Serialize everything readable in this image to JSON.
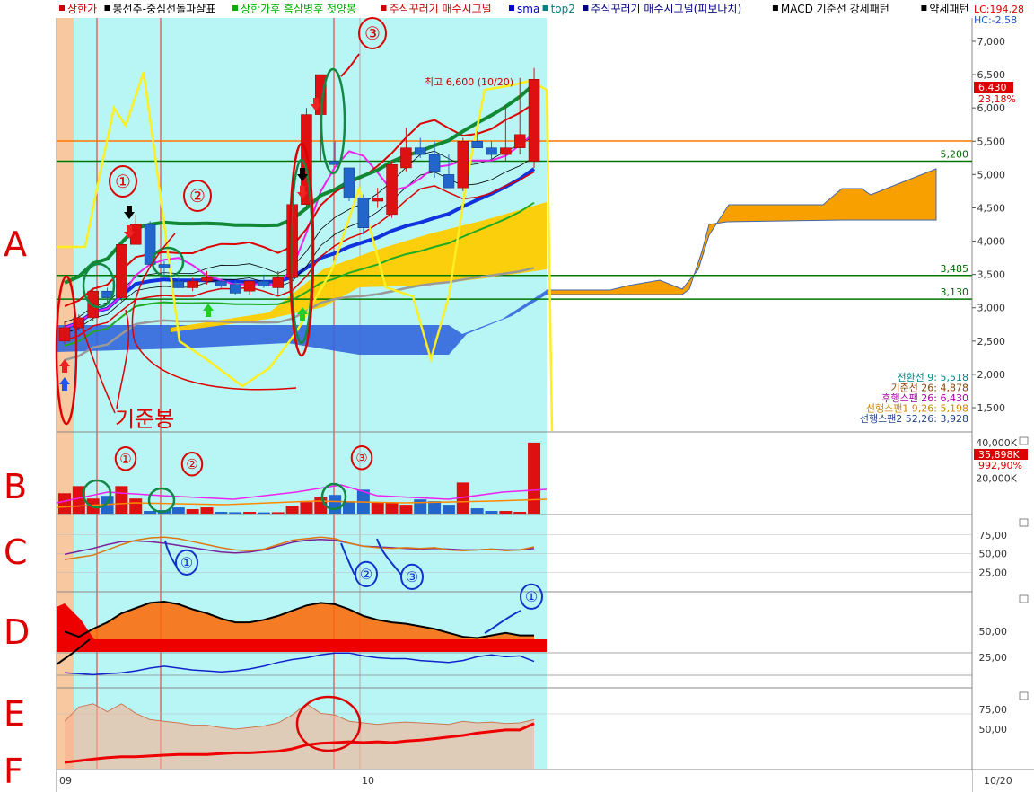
{
  "legend": [
    {
      "label": "상한가",
      "color": "#cc0000"
    },
    {
      "label": "봉선추-중심선돌파샬표",
      "color": "#000000"
    },
    {
      "label": "상한가후 흑삼병후 첫양봉",
      "color": "#00b000"
    },
    {
      "label": "주식꾸러기 매수시그널",
      "color": "#cc0000"
    },
    {
      "label": "sma",
      "color": "#0000cc"
    },
    {
      "label": "top2",
      "color": "#008080"
    },
    {
      "label": "주식꾸러기 매수시그널(피보나치)",
      "color": "#000080"
    },
    {
      "label": "MACD 기준선 강세패턴",
      "color": "#000000"
    },
    {
      "label": "약세패턴",
      "color": "#000000"
    }
  ],
  "top_right": {
    "lc": "LC:194,28",
    "hc": "HC:-2,58"
  },
  "price_axis": {
    "ticks": [
      "7,000",
      "6,500",
      "6,000",
      "5,500",
      "5,000",
      "4,500",
      "4,000",
      "3,500",
      "3,000",
      "2,500",
      "2,000",
      "1,500"
    ]
  },
  "price_badge": {
    "price": "6,430",
    "pct": "23,18%"
  },
  "high_marker": "최고 6,600 (10/20)",
  "hlines": [
    {
      "label": "5,200",
      "color": "#007700"
    },
    {
      "label": "3,485",
      "color": "#007700"
    },
    {
      "label": "3,130",
      "color": "#007700"
    }
  ],
  "ichimoku_legend": [
    {
      "text": "전환선 9: 5,518",
      "color": "#008888"
    },
    {
      "text": "기준선 26: 4,878",
      "color": "#884400"
    },
    {
      "text": "후행스팬 26: 6,430",
      "color": "#aa00aa"
    },
    {
      "text": "선행스팬1 9,26: 5,198",
      "color": "#cc8800"
    },
    {
      "text": "선행스팬2 52,26: 3,928",
      "color": "#224488"
    }
  ],
  "volume_axis": {
    "ticks": [
      "40,000K",
      "20,000K"
    ],
    "badge": "35,898K",
    "badge_pct": "992,90%"
  },
  "osc_axis_c": [
    "75,00",
    "50,00",
    "25,00"
  ],
  "osc_axis_d": [
    "50,00",
    "25,00"
  ],
  "osc_axis_e": [
    "75,00",
    "50,00"
  ],
  "date_labels": [
    "09",
    "10"
  ],
  "date_right": "10/20",
  "side_letters": [
    "A",
    "B",
    "C",
    "D",
    "E",
    "F"
  ],
  "annotations": [
    "①",
    "②",
    "③",
    "①",
    "②",
    "③",
    "①",
    "②",
    "③",
    "①",
    "기준봉"
  ],
  "colors": {
    "up": "#dd1111",
    "down": "#2266cc",
    "highlight": "#b8f6f6",
    "orange_band": "#f8c8a0",
    "cloud": "#f8a000",
    "annot": "#dd0000"
  },
  "chart_data": {
    "type": "candlestick",
    "dates": [
      "2009-09-01",
      "2009-09-02",
      "2009-09-03",
      "2009-09-04",
      "2009-09-07",
      "2009-09-08",
      "2009-09-09",
      "2009-09-10",
      "2009-09-11",
      "2009-09-14",
      "2009-09-15",
      "2009-09-16",
      "2009-09-17",
      "2009-09-18",
      "2009-09-21",
      "2009-09-22",
      "2009-09-23",
      "2009-09-24",
      "2009-09-25",
      "2009-09-28",
      "2009-09-29",
      "2009-09-30",
      "2009-10-05",
      "2009-10-06",
      "2009-10-07",
      "2009-10-08",
      "2009-10-09",
      "2009-10-12",
      "2009-10-13",
      "2009-10-14",
      "2009-10-15",
      "2009-10-16",
      "2009-10-19",
      "2009-10-20"
    ],
    "ohlc": [
      [
        2500,
        2800,
        2450,
        2700
      ],
      [
        2700,
        2900,
        2650,
        2850
      ],
      [
        2850,
        3300,
        2800,
        3250
      ],
      [
        3250,
        3300,
        3050,
        3150
      ],
      [
        3150,
        3950,
        3100,
        3950
      ],
      [
        3950,
        4400,
        3950,
        4250
      ],
      [
        4250,
        4300,
        3600,
        3650
      ],
      [
        3650,
        3700,
        3450,
        3600
      ],
      [
        3400,
        3450,
        3300,
        3300
      ],
      [
        3300,
        3450,
        3250,
        3400
      ],
      [
        3400,
        3550,
        3350,
        3450
      ],
      [
        3400,
        3420,
        3300,
        3330
      ],
      [
        3350,
        3400,
        3200,
        3220
      ],
      [
        3250,
        3420,
        3200,
        3400
      ],
      [
        3400,
        3500,
        3300,
        3330
      ],
      [
        3300,
        3550,
        3200,
        3450
      ],
      [
        3450,
        4550,
        3400,
        4550
      ],
      [
        4550,
        6000,
        4500,
        5900
      ],
      [
        5900,
        6500,
        5200,
        6500
      ],
      [
        5200,
        5500,
        5150,
        5150
      ],
      [
        5100,
        5100,
        4600,
        4650
      ],
      [
        4650,
        4700,
        4100,
        4200
      ],
      [
        4600,
        4800,
        4500,
        4650
      ],
      [
        4400,
        5200,
        4350,
        5150
      ],
      [
        5100,
        5700,
        5050,
        5400
      ],
      [
        5400,
        5550,
        5250,
        5300
      ],
      [
        5300,
        5500,
        4950,
        5050
      ],
      [
        5000,
        5300,
        4800,
        4800
      ],
      [
        4800,
        5550,
        4750,
        5500
      ],
      [
        5500,
        5650,
        5400,
        5400
      ],
      [
        5400,
        5500,
        5200,
        5300
      ],
      [
        5300,
        6050,
        5200,
        5400
      ],
      [
        5400,
        6450,
        5300,
        5600
      ],
      [
        5200,
        6600,
        5100,
        6430
      ]
    ],
    "volume_k": [
      11500,
      15500,
      8500,
      10000,
      15500,
      8500,
      1500,
      2000,
      3500,
      2500,
      3500,
      1000,
      800,
      1000,
      700,
      800,
      4500,
      6500,
      9500,
      10500,
      7000,
      13500,
      6500,
      6000,
      5000,
      8000,
      7000,
      5000,
      17500,
      3000,
      1500,
      1500,
      1000,
      40000
    ],
    "y_price_range": [
      1150,
      7350
    ],
    "y_volume_range": [
      0,
      45000
    ],
    "series": [
      {
        "name": "전환선 9",
        "last": 5518
      },
      {
        "name": "기준선 26",
        "last": 4878
      },
      {
        "name": "후행스팬 26",
        "last": 6430
      },
      {
        "name": "선행스팬1 9,26",
        "last": 5198
      },
      {
        "name": "선행스팬2 52,26",
        "last": 3928
      }
    ],
    "horizontal_levels": [
      5200,
      3485,
      3130
    ],
    "high": 6600,
    "osc_c": {
      "range": [
        0,
        100
      ],
      "a": [
        49,
        53,
        57,
        62,
        66,
        67,
        66,
        64,
        61,
        58,
        55,
        52,
        51,
        52,
        55,
        60,
        65,
        68,
        69,
        68,
        64,
        60,
        59,
        58,
        57,
        56,
        57,
        56,
        55,
        55,
        56,
        55,
        55,
        57
      ],
      "b": [
        42,
        45,
        48,
        55,
        62,
        68,
        71,
        72,
        70,
        66,
        62,
        58,
        55,
        54,
        56,
        62,
        68,
        70,
        72,
        70,
        64,
        60,
        58,
        57,
        58,
        57,
        58,
        55,
        54,
        55,
        56,
        54,
        55,
        59
      ]
    },
    "osc_d": {
      "range": [
        0,
        100
      ],
      "area": [
        48,
        44,
        50,
        55,
        62,
        66,
        70,
        71,
        69,
        65,
        62,
        58,
        55,
        55,
        57,
        60,
        64,
        68,
        70,
        69,
        65,
        60,
        57,
        55,
        54,
        52,
        50,
        47,
        44,
        43,
        45,
        47,
        45,
        45
      ],
      "blue": [
        15,
        14,
        13,
        14,
        15,
        17,
        20,
        22,
        20,
        18,
        17,
        16,
        17,
        19,
        22,
        26,
        29,
        31,
        34,
        36,
        36,
        33,
        31,
        30,
        30,
        28,
        27,
        26,
        28,
        32,
        34,
        32,
        33,
        27
      ]
    },
    "osc_e": {
      "range": [
        0,
        100
      ],
      "band": [
        60,
        78,
        82,
        72,
        82,
        70,
        62,
        60,
        58,
        55,
        55,
        52,
        50,
        52,
        54,
        58,
        68,
        82,
        70,
        68,
        60,
        58,
        56,
        58,
        59,
        58,
        57,
        56,
        60,
        58,
        59,
        57,
        58,
        62
      ],
      "red": [
        8,
        10,
        12,
        14,
        15,
        15,
        16,
        17,
        18,
        18,
        18,
        19,
        20,
        20,
        21,
        22,
        25,
        30,
        32,
        33,
        34,
        33,
        34,
        33,
        35,
        36,
        38,
        40,
        42,
        45,
        47,
        49,
        49,
        57
      ]
    }
  }
}
